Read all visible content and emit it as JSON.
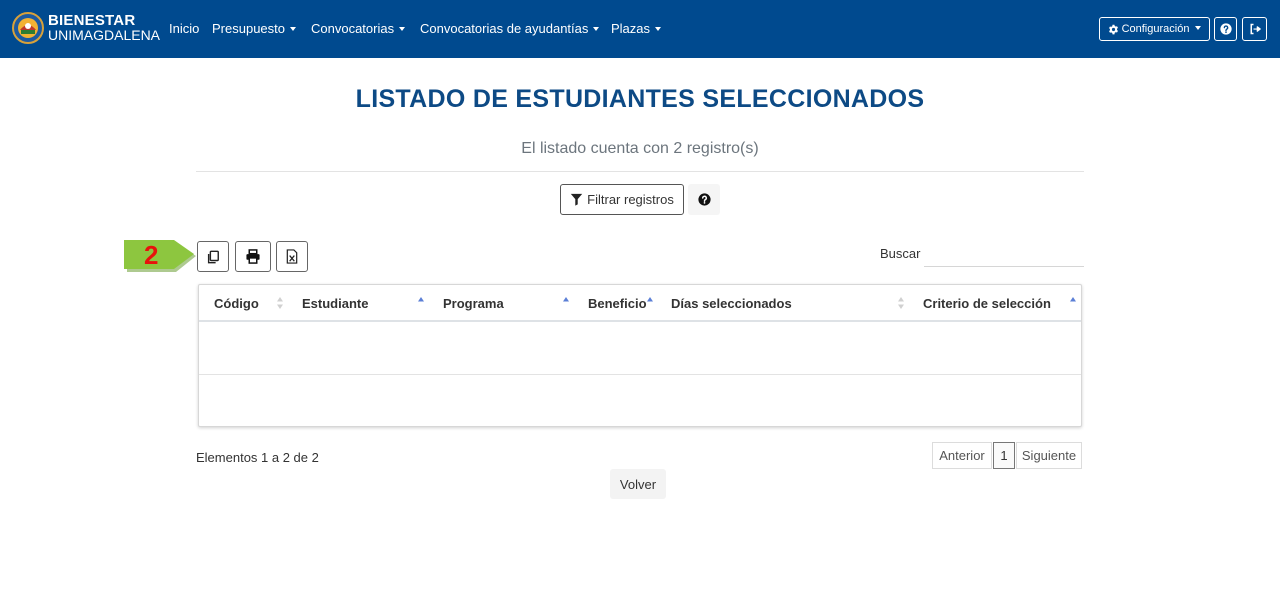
{
  "brand": {
    "line1": "BIENESTAR",
    "line2": "UNIMAGDALENA",
    "logo_icon": "unimagdalena-seal-icon"
  },
  "nav": {
    "items": [
      {
        "label": "Inicio",
        "dropdown": false
      },
      {
        "label": "Presupuesto",
        "dropdown": true
      },
      {
        "label": "Convocatorias",
        "dropdown": true
      },
      {
        "label": "Convocatorias de ayudantías",
        "dropdown": true
      },
      {
        "label": "Plazas",
        "dropdown": true
      }
    ],
    "config_label": "Configuración",
    "config_icon": "gear-icon",
    "help_icon": "question-circle-icon",
    "logout_icon": "sign-out-icon",
    "bg_color": "#004a8f"
  },
  "page": {
    "title": "LISTADO DE ESTUDIANTES SELECCIONADOS",
    "subtitle": "El listado cuenta con 2 registro(s)",
    "title_color": "#0d4a85"
  },
  "filter": {
    "label": "Filtrar registros",
    "icon": "filter-icon",
    "help_icon": "question-circle-icon"
  },
  "step_marker": {
    "number": "2",
    "arrow_color": "#7dc243",
    "number_color": "#e8120c"
  },
  "export": {
    "copy_icon": "copy-icon",
    "print_icon": "print-icon",
    "excel_icon": "excel-file-icon"
  },
  "search": {
    "label": "Buscar",
    "value": ""
  },
  "table": {
    "columns": [
      "Código",
      "Estudiante",
      "Programa",
      "Beneficio",
      "Días seleccionados",
      "Criterio de selección"
    ],
    "rows": [
      [
        "",
        "",
        "",
        "",
        "",
        ""
      ],
      [
        "",
        "",
        "",
        "",
        "",
        ""
      ]
    ]
  },
  "footer": {
    "info": "Elementos 1 a 2 de 2",
    "prev": "Anterior",
    "page": "1",
    "next": "Siguiente",
    "back": "Volver"
  }
}
